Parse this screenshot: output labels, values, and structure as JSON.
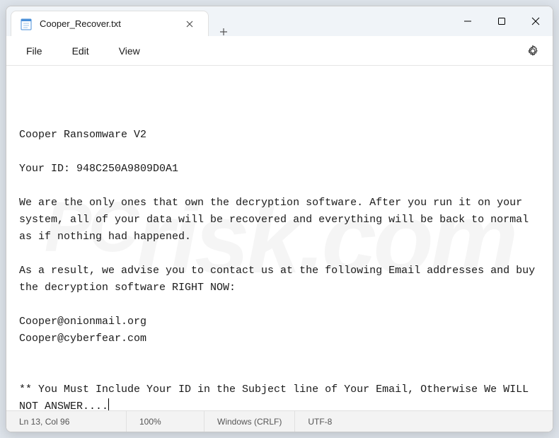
{
  "tab": {
    "title": "Cooper_Recover.txt"
  },
  "menu": {
    "file": "File",
    "edit": "Edit",
    "view": "View"
  },
  "document": {
    "line1": "Cooper Ransomware V2",
    "line2": "Your ID: 948C250A9809D0A1",
    "line3": "We are the only ones that own the decryption software. After you run it on your system, all of your data will be recovered and everything will be back to normal as if nothing had happened.",
    "line4": "As a result, we advise you to contact us at the following Email addresses and buy the decryption software RIGHT NOW:",
    "line5": "Cooper@onionmail.org",
    "line6": "Cooper@cyberfear.com",
    "line7": "** You Must Include Your ID in the Subject line of Your Email, Otherwise We WILL NOT ANSWER...."
  },
  "status": {
    "position": "Ln 13, Col 96",
    "zoom": "100%",
    "eol": "Windows (CRLF)",
    "encoding": "UTF-8"
  }
}
